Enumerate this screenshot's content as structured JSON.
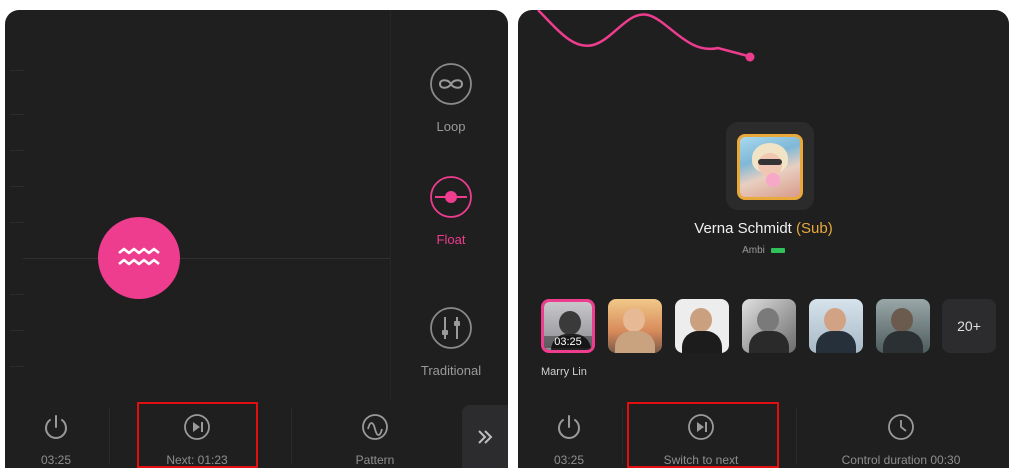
{
  "left_panel": {
    "modes": [
      {
        "icon": "infinity-icon",
        "label": "Loop",
        "active": false
      },
      {
        "icon": "float-icon",
        "label": "Float",
        "active": true
      },
      {
        "icon": "sliders-icon",
        "label": "Traditional",
        "active": false
      }
    ],
    "bottom": {
      "power_time": "03:25",
      "next_label": "Next: 01:23",
      "pattern_label": "Pattern"
    }
  },
  "right_panel": {
    "user": {
      "name": "Verna Schmidt",
      "tag": "(Sub)",
      "toy": "Ambi"
    },
    "thumbnails": [
      {
        "time": "03:25",
        "selected": true
      },
      {
        "time": "",
        "selected": false
      },
      {
        "time": "",
        "selected": false
      },
      {
        "time": "",
        "selected": false
      },
      {
        "time": "",
        "selected": false
      },
      {
        "time": "",
        "selected": false
      }
    ],
    "more_count": "20+",
    "selected_name": "Marry Lin",
    "bottom": {
      "power_time": "03:25",
      "switch_label": "Switch to next",
      "control_label": "Control duration 00:30"
    }
  },
  "colors": {
    "accent": "#ee3c8e",
    "sub": "#e8a83a",
    "battery": "#2fc25b",
    "highlight_box": "#e01010"
  }
}
